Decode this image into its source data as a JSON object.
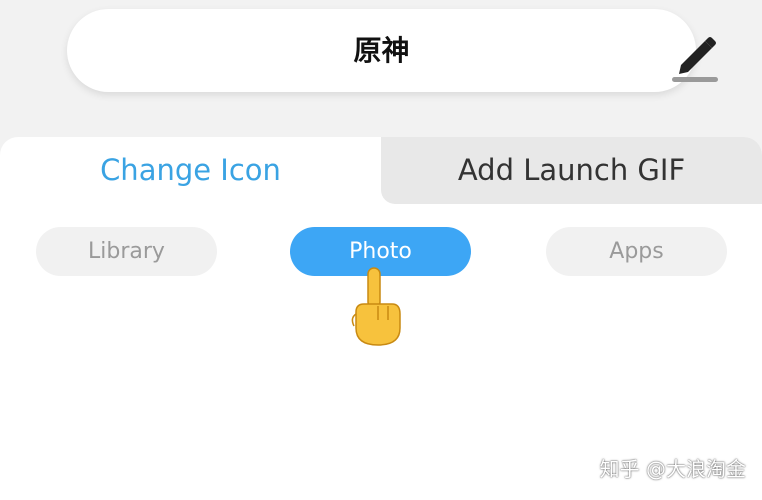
{
  "app_name": {
    "value": "原神",
    "edit_icon": "pencil-edit-icon"
  },
  "tabs": [
    {
      "label": "Change Icon",
      "active": true
    },
    {
      "label": "Add Launch GIF",
      "active": false
    }
  ],
  "sources": [
    {
      "label": "Library",
      "selected": false
    },
    {
      "label": "Photo",
      "selected": true
    },
    {
      "label": "Apps",
      "selected": false
    }
  ],
  "overlay": {
    "pointer": "pointing-hand-icon"
  },
  "watermark": "知乎 @大浪淘金",
  "colors": {
    "accent": "#3aa3e3",
    "selected_pill": "#3da6f5",
    "inactive_text": "#9a9a9a",
    "page_background": "#f2f2f2"
  }
}
